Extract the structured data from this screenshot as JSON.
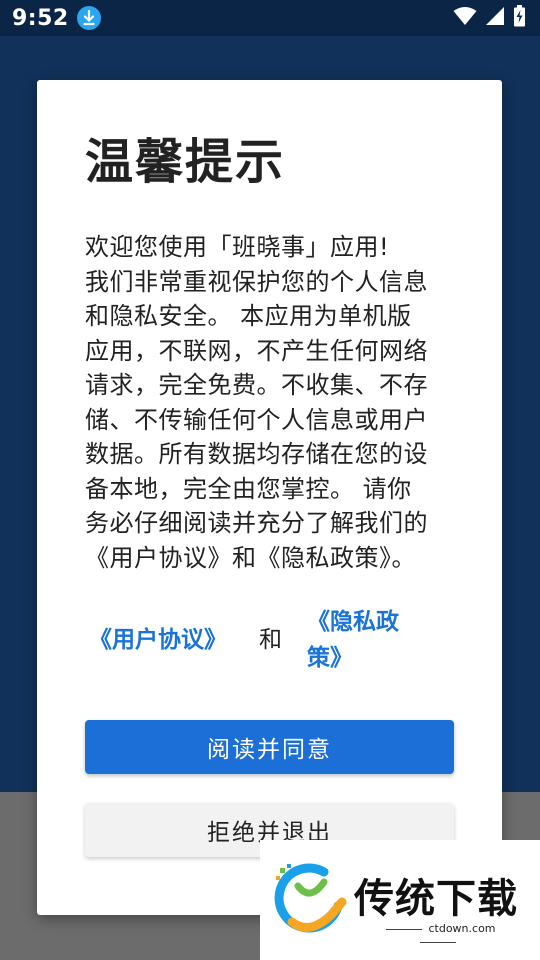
{
  "status_bar": {
    "time": "9:52",
    "icons": [
      "download-icon",
      "wifi-icon",
      "signal-icon",
      "battery-charging-icon"
    ]
  },
  "dialog": {
    "title": "温馨提示",
    "body_lines": [
      "欢迎您使用「班晓事」应用!",
      "我们非常重视保护您的个人信息",
      "和隐私安全。 本应用为单机版",
      "应用，不联网，不产生任何网络",
      "请求，完全免费。不收集、不存",
      "储、不传输任何个人信息或用户",
      "数据。所有数据均存储在您的设",
      "备本地，完全由您掌控。 请你",
      "务必仔细阅读并充分了解我们的",
      "《用户协议》和《隐私政策》。"
    ],
    "links": {
      "user_agreement": "《用户协议》",
      "and": "和",
      "privacy_policy": "《隐私政策》"
    },
    "buttons": {
      "agree": "阅读并同意",
      "decline": "拒绝并退出"
    }
  },
  "watermark": {
    "brand": "传统下载",
    "domain": "ctdown.com"
  },
  "colors": {
    "status_bar": "#0b2546",
    "background": "#11315a",
    "overlay": "#6c6c6c",
    "link": "#1a73d9",
    "primary_button": "#1c6fd6"
  }
}
